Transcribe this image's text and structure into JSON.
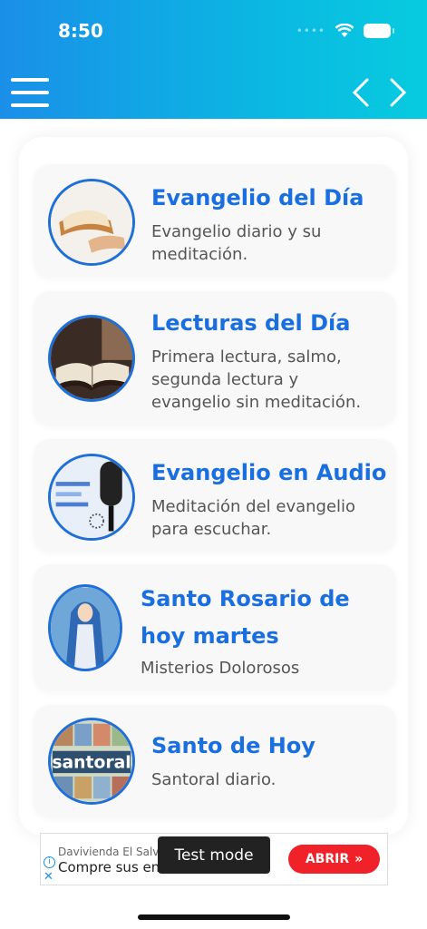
{
  "status": {
    "time": "8:50"
  },
  "header": {
    "menu_icon": "hamburger-menu-icon",
    "prev_icon": "chevron-left-icon",
    "next_icon": "chevron-right-icon"
  },
  "items": [
    {
      "title": "Evangelio del Día",
      "description": "Evangelio diario y su meditación.",
      "icon": "open-bible-hand-image"
    },
    {
      "title": "Lecturas del Día",
      "description": "Primera lectura, salmo, segunda lectura y evangelio sin meditación.",
      "icon": "bible-on-table-image"
    },
    {
      "title": "Evangelio en Audio",
      "description": "Meditación del evangelio para escuchar.",
      "icon": "microphone-rosary-image"
    },
    {
      "title": "Santo Rosario de hoy martes",
      "description": "Misterios Dolorosos",
      "icon": "virgin-mary-image"
    },
    {
      "title": "Santo de Hoy",
      "description": "Santoral diario.",
      "icon": "santoral-collage-image"
    }
  ],
  "ad": {
    "sponsor": "Davivienda El Salvador",
    "headline": "Compre sus entradas",
    "button_label": "ABRIR",
    "toast": "Test mode",
    "brand_color": "#f02128"
  }
}
